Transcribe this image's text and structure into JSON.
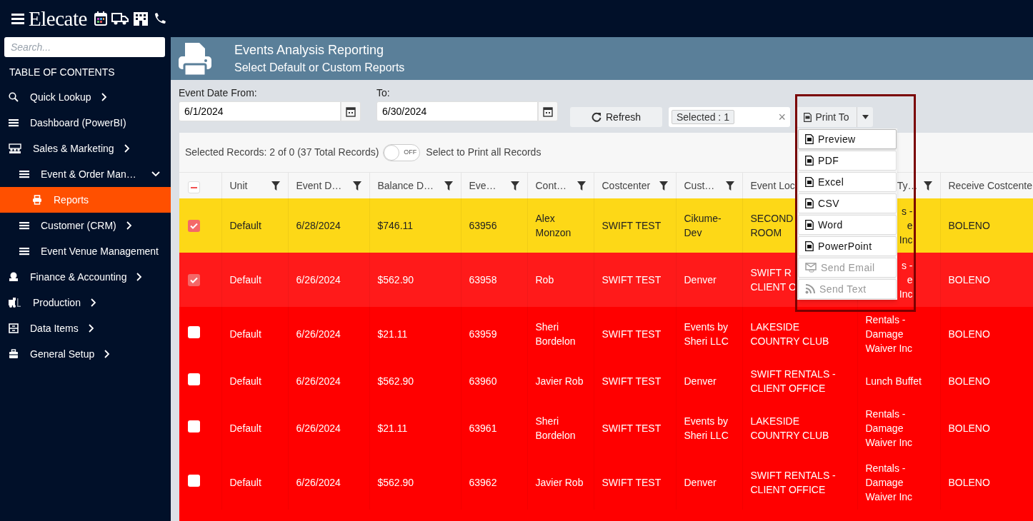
{
  "topbar": {
    "logo": "Elecate"
  },
  "sidebar": {
    "search": {
      "placeholder": "Search..."
    },
    "heading": "TABLE OF CONTENTS",
    "items": [
      {
        "label": "Quick Lookup",
        "kind": "group",
        "expanded": false,
        "selected": false
      },
      {
        "label": "Dashboard (PowerBI)",
        "kind": "link",
        "selected": false
      },
      {
        "label": "Sales & Marketing",
        "kind": "group",
        "expanded": false,
        "selected": false,
        "children": [
          {
            "label": "Event & Order Man…",
            "kind": "group",
            "expanded": true,
            "selected": false,
            "children": [
              {
                "label": "Reports",
                "kind": "link",
                "selected": true
              }
            ]
          },
          {
            "label": "Customer (CRM)",
            "kind": "group",
            "expanded": false,
            "selected": false
          },
          {
            "label": "Event Venue Management",
            "kind": "link",
            "selected": false
          }
        ]
      },
      {
        "label": "Finance & Accounting",
        "kind": "group",
        "expanded": false,
        "selected": false
      },
      {
        "label": "Production",
        "kind": "group",
        "expanded": false,
        "selected": false
      },
      {
        "label": "Data Items",
        "kind": "group",
        "expanded": false,
        "selected": false
      },
      {
        "label": "General Setup",
        "kind": "group",
        "expanded": false,
        "selected": false
      }
    ]
  },
  "header": {
    "title": "Events Analysis Reporting",
    "subtitle": "Select Default or Custom Reports"
  },
  "filters": {
    "from_label": "Event Date From:",
    "from_value": "6/1/2024",
    "to_label": "To:",
    "to_value": "6/30/2024",
    "refresh": "Refresh",
    "selected_tag": "Selected : 1",
    "clear": "×",
    "print_to": "Print To"
  },
  "records": {
    "summary": "Selected Records: 2 of 0 (37 Total Records)",
    "toggle_on": false,
    "toggle_text": "OFF",
    "toggle_label": "Select to Print all Records"
  },
  "table": {
    "header_checkbox": {
      "indeterminate": true
    },
    "columns": [
      {
        "label": "Unit",
        "filter": true
      },
      {
        "label": "Event D…",
        "filter": true
      },
      {
        "label": "Balance D…",
        "filter": true
      },
      {
        "label": "Eve…",
        "filter": true
      },
      {
        "label": "Cont…",
        "filter": true
      },
      {
        "label": "Costcenter",
        "filter": true
      },
      {
        "label": "Cust…",
        "filter": true
      },
      {
        "label": "Event Loc"
      },
      {
        "label": "Ty…",
        "filter": true,
        "covered": true
      },
      {
        "label": "Receive Costcente"
      }
    ],
    "rows": [
      {
        "selected": true,
        "color": "#fdd817",
        "cells": [
          "Default",
          "6/28/2024",
          "$746.11",
          "63956",
          "Alex Monzon",
          "SWIFT TEST",
          "Cikume-Dev",
          {
            "text": "SECOND\nROOM",
            "covered": false
          },
          {
            "text": "s -\ne\nInc",
            "covered": true
          },
          "BOLENO"
        ]
      },
      {
        "selected": true,
        "color": "#ff1a1a",
        "cells": [
          "Default",
          "6/26/2024",
          "$562.90",
          "63958",
          "Rob",
          "SWIFT TEST",
          "Denver",
          {
            "text": "SWIFT R\nCLIENT O",
            "covered": false
          },
          {
            "text": "s -\ne\nInc",
            "covered": true
          },
          "BOLENO"
        ]
      },
      {
        "selected": false,
        "color": "#ff0000",
        "cells": [
          "Default",
          "6/26/2024",
          "$21.11",
          "63959",
          "Sheri Bordelon",
          "SWIFT TEST",
          "Events by Sheri LLC",
          "LAKESIDE COUNTRY CLUB",
          "Rentals - Damage Waiver Inc",
          "BOLENO"
        ]
      },
      {
        "selected": false,
        "color": "#ff0000",
        "cells": [
          "Default",
          "6/26/2024",
          "$562.90",
          "63960",
          "Javier Rob",
          "SWIFT TEST",
          "Denver",
          "SWIFT RENTALS - CLIENT OFFICE",
          "Lunch Buffet",
          "BOLENO"
        ]
      },
      {
        "selected": false,
        "color": "#ff0000",
        "cells": [
          "Default",
          "6/26/2024",
          "$21.11",
          "63961",
          "Sheri Bordelon",
          "SWIFT TEST",
          "Events by Sheri LLC",
          "LAKESIDE COUNTRY CLUB",
          "Rentals - Damage Waiver Inc",
          "BOLENO"
        ]
      },
      {
        "selected": false,
        "color": "#ff0000",
        "cells": [
          "Default",
          "6/26/2024",
          "$562.90",
          "63962",
          "Javier Rob",
          "SWIFT TEST",
          "Denver",
          "SWIFT RENTALS - CLIENT OFFICE",
          "Rentals - Damage Waiver Inc",
          "BOLENO"
        ]
      }
    ]
  },
  "print_menu": {
    "items": [
      {
        "label": "Preview",
        "selected": true,
        "disabled": false
      },
      {
        "label": "PDF",
        "selected": false,
        "disabled": false
      },
      {
        "label": "Excel",
        "selected": false,
        "disabled": false
      },
      {
        "label": "CSV",
        "selected": false,
        "disabled": false
      },
      {
        "label": "Word",
        "selected": false,
        "disabled": false
      },
      {
        "label": "PowerPoint",
        "selected": false,
        "disabled": false
      },
      {
        "label": "Send Email",
        "selected": false,
        "disabled": true
      },
      {
        "label": "Send Text",
        "selected": false,
        "disabled": true
      }
    ]
  }
}
